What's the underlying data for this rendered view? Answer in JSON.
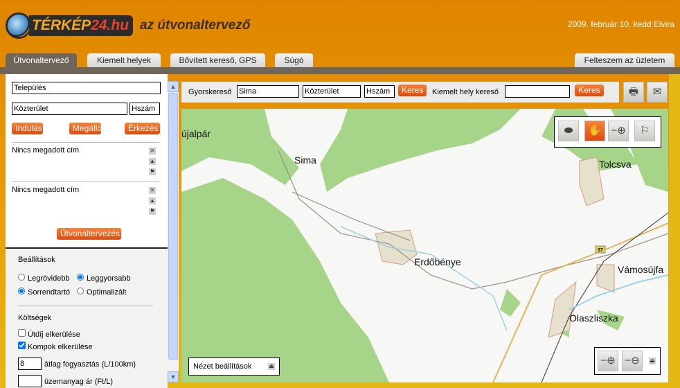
{
  "header": {
    "logo_text": "TÉRKÉP24.hu",
    "slogan": "az útvonaltervező",
    "date": "2009. február 10. kedd Elvira"
  },
  "tabs": [
    {
      "label": "Útvonaltervező",
      "active": true
    },
    {
      "label": "Kiemelt helyek"
    },
    {
      "label": "Bővített kereső, GPS"
    },
    {
      "label": "Súgó"
    }
  ],
  "right_tab": "Felteszem az üzletem",
  "route": {
    "city": "Település",
    "street": "Közterület",
    "number": "Hszám",
    "btn_start": "Indulás",
    "btn_stop": "Megálló",
    "btn_end": "Érkezés",
    "waypoints": [
      "Nincs megadott cím",
      "Nincs megadott cím"
    ],
    "plan_button": "Útvonaltervezés"
  },
  "settings": {
    "title": "Beállítások",
    "opt_shortest": "Legrövidebb",
    "opt_fastest": "Leggyorsabb",
    "opt_ordered": "Sorrendtartó",
    "opt_optimized": "Optimalizált",
    "selected_mode": "Leggyorsabb",
    "selected_order": "Sorrendtartó"
  },
  "costs": {
    "title": "Költségek",
    "avoid_toll": "Útdíj elkerülése",
    "avoid_toll_checked": false,
    "avoid_ferry": "Kompok elkerülése",
    "avoid_ferry_checked": true,
    "consumption_value": "8",
    "consumption_label": "átlag fogyasztás (L/100km)",
    "fuel_price_value": "",
    "fuel_price_label": "üzemanyag ár (Ft/L)"
  },
  "toolbar": {
    "quick_label": "Gyorskereső",
    "quick_city": "Sima",
    "quick_street": "Közterület",
    "quick_number": "Hszám",
    "search": "Keres",
    "poi_label": "Kiemelt hely kereső",
    "poi_value": "",
    "poi_search": "Keres"
  },
  "map": {
    "towns": [
      "újalpár",
      "Sima",
      "Tolcsva",
      "Erdőbénye",
      "Vámosújfa",
      "Olaszliszka"
    ],
    "road_number": "37",
    "view_settings": "Nézet beállítások",
    "active_tool": "pan"
  },
  "colors": {
    "accent": "#e8581a",
    "forest": "#a6d58a",
    "header": "#e48f05"
  }
}
